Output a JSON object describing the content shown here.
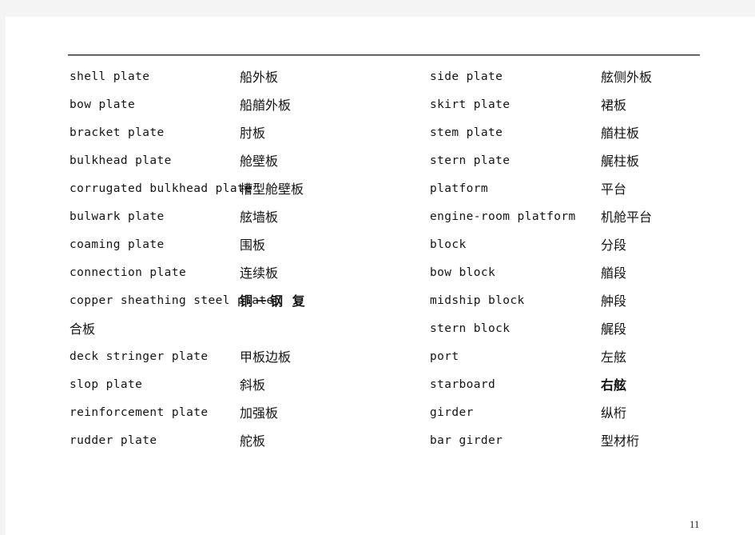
{
  "page": {
    "page_number": "11",
    "background_color": "#f4f4f4",
    "sheet_color": "#ffffff",
    "rule_color": "#3c3c3c",
    "text_color": "#141414"
  },
  "glossary": {
    "left_column": [
      {
        "en": "shell plate",
        "zh": "船外板"
      },
      {
        "en": "bow plate",
        "zh": "船艏外板"
      },
      {
        "en": "bracket plate",
        "zh": "肘板"
      },
      {
        "en": "bulkhead plate",
        "zh": "舱壁板"
      },
      {
        "en": "corrugated bulkhead plate",
        "zh": "槽型舱壁板"
      },
      {
        "en": "bulwark plate",
        "zh": "舷墙板"
      },
      {
        "en": "coaming plate",
        "zh": "围板"
      },
      {
        "en": "connection plate",
        "zh": "连续板"
      },
      {
        "en": "copper sheathing steel plate",
        "zh": "铜－钢 复",
        "zh_wrap": "合板"
      },
      {
        "en": "deck stringer plate",
        "zh": "甲板边板"
      },
      {
        "en": "slop plate",
        "zh": "斜板"
      },
      {
        "en": "reinforcement plate",
        "zh": "加强板"
      },
      {
        "en": "rudder plate",
        "zh": "舵板"
      }
    ],
    "right_column": [
      {
        "en": "side plate",
        "zh": "舷侧外板"
      },
      {
        "en": "skirt plate",
        "zh": "裙板"
      },
      {
        "en": "stem plate",
        "zh": "艏柱板"
      },
      {
        "en": "stern plate",
        "zh": "艉柱板"
      },
      {
        "en": "platform",
        "zh": "平台"
      },
      {
        "en": "engine-room platform",
        "zh": "机舱平台"
      },
      {
        "en": "block",
        "zh": "分段"
      },
      {
        "en": "bow block",
        "zh": "艏段"
      },
      {
        "en": "midship block",
        "zh": "舯段"
      },
      {
        "en": "stern block",
        "zh": "艉段"
      },
      {
        "en": "port",
        "zh": "左舷"
      },
      {
        "en": "starboard",
        "zh": "右舷"
      },
      {
        "en": "girder",
        "zh": "纵桁"
      },
      {
        "en": "bar girder",
        "zh": "型材桁"
      }
    ]
  }
}
